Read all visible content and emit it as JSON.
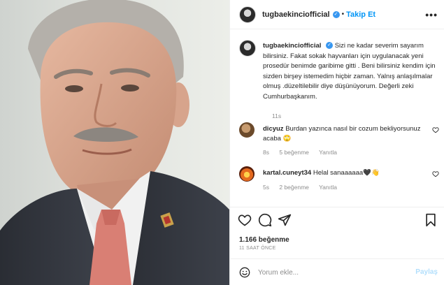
{
  "header": {
    "username": "tugbaekincio fficial",
    "follow_label": "Takip Et",
    "separator": "•",
    "more": "•••"
  },
  "caption": {
    "username": "tugbaekinciofficial",
    "text": "Sizi ne kadar severim sayarım bilirsiniz. Fakat sokak hayvanları için uygulanacak yeni prosedür benimde garibime gitti . Beni bilirsiniz kendim için sizden birşey istemedim hiçbir zaman. Yalnış anlaşılmalar olmuş .düzeltilebilir diye düşünüyorum. Değerli zeki Cumhurbaşkanım.",
    "time": "11s"
  },
  "comments": [
    {
      "username": "dicyuz",
      "text": "Burdan yazınca nasıl bir cozum bekliyorsunuz acaba 🙄",
      "time": "8s",
      "likes": "5 beğenme",
      "reply": "Yanıtla"
    },
    {
      "username": "kartal.cuneyt34",
      "text": "Helal sanaaaaaa🖤👋",
      "time": "5s",
      "likes": "2 beğenme",
      "reply": "Yanıtla"
    }
  ],
  "likes": "1.166 beğenme",
  "posted_ago": "11 SAAT ÖNCE",
  "compose": {
    "placeholder": "Yorum ekle...",
    "share_label": "Paylaş"
  },
  "colors": {
    "link": "#0095f6",
    "muted": "#8e8e8e",
    "verified": "#3897f0"
  }
}
